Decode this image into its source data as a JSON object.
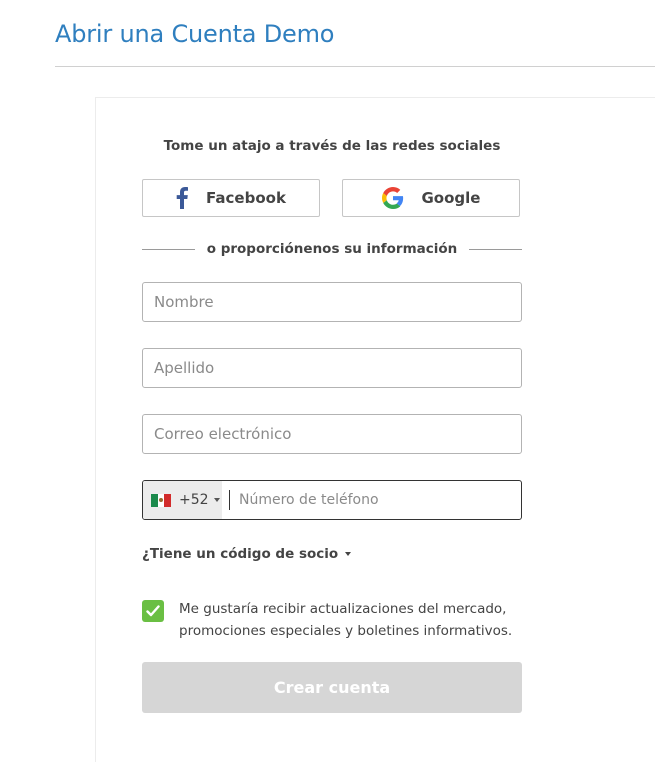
{
  "page": {
    "title": "Abrir una Cuenta Demo"
  },
  "social": {
    "heading": "Tome un atajo a través de las redes sociales",
    "facebook_label": "Facebook",
    "google_label": "Google"
  },
  "divider": {
    "text": "o proporciónenos su información"
  },
  "form": {
    "first_name_placeholder": "Nombre",
    "first_name_value": "",
    "last_name_placeholder": "Apellido",
    "last_name_value": "",
    "email_placeholder": "Correo electrónico",
    "email_value": "",
    "phone": {
      "country_icon": "mexico-flag-icon",
      "dial_code": "+52",
      "placeholder": "Número de teléfono",
      "value": ""
    },
    "partner_code_label": "¿Tiene un código de socio",
    "consent": {
      "checked": true,
      "text": "Me gustaría recibir actualizaciones del mercado, promociones especiales y boletines informativos."
    },
    "submit_label": "Crear cuenta"
  },
  "colors": {
    "title": "#2f7fbf",
    "checkbox": "#6abf43",
    "submit_disabled": "#d6d6d6",
    "facebook_blue": "#3b5998"
  }
}
